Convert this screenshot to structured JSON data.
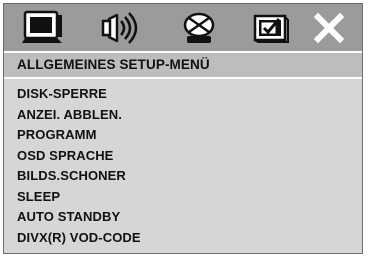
{
  "toolbar": {
    "icons": [
      {
        "name": "general-setup-icon",
        "selected": true
      },
      {
        "name": "audio-setup-icon",
        "selected": false
      },
      {
        "name": "dolby-setup-icon",
        "selected": false
      },
      {
        "name": "preferences-icon",
        "selected": false
      },
      {
        "name": "exit-icon",
        "selected": false
      }
    ],
    "accent_colors": {
      "bar": "#9b9b9b",
      "header": "#bdbdbd",
      "menu": "#d6d6d6"
    }
  },
  "header": {
    "title": "ALLGEMEINES SETUP-MENÜ"
  },
  "menu": {
    "items": [
      {
        "label": "DISK-SPERRE"
      },
      {
        "label": "ANZEI. ABBLEN."
      },
      {
        "label": "PROGRAMM"
      },
      {
        "label": "OSD SPRACHE"
      },
      {
        "label": "BILDS.SCHONER"
      },
      {
        "label": "SLEEP"
      },
      {
        "label": "AUTO STANDBY"
      },
      {
        "label": "DIVX(R) VOD-CODE"
      }
    ]
  }
}
